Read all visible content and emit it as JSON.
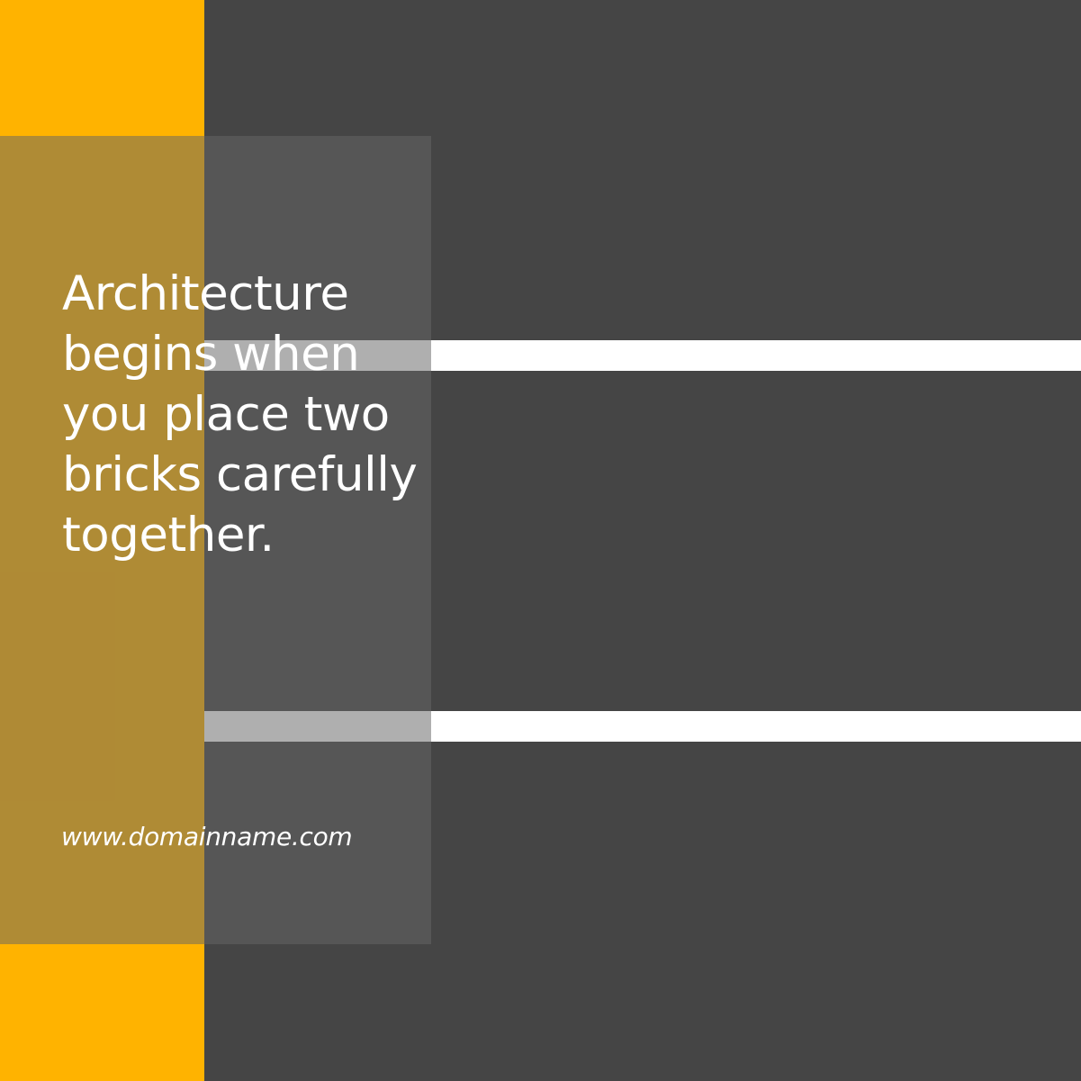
{
  "quote": {
    "text": "Architecture begins when you place two bricks carefully together."
  },
  "website": {
    "url": "www.domainname.com"
  },
  "colors": {
    "background": "#454545",
    "accent": "#FFB300",
    "stripe": "#FFFFFF",
    "text": "#FFFFFF"
  }
}
